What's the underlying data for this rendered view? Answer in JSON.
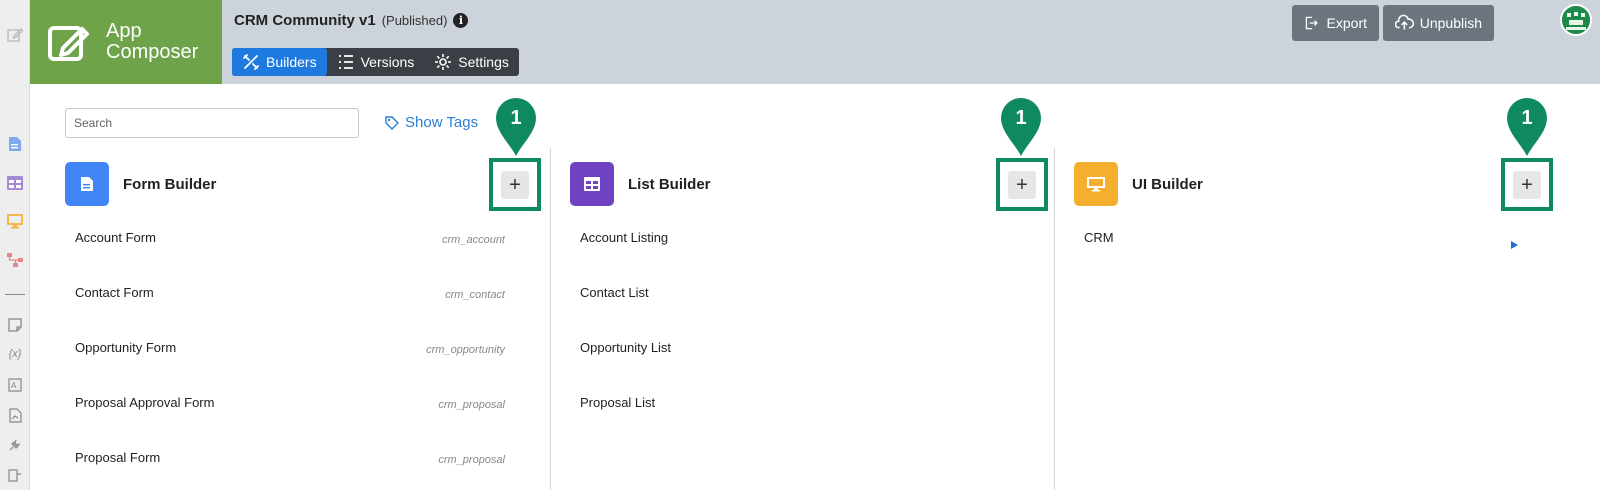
{
  "brand": {
    "line1": "App",
    "line2": "Composer"
  },
  "app": {
    "title": "CRM Community v1",
    "status": "(Published)",
    "info_icon": "i"
  },
  "tabs": [
    {
      "label": "Builders",
      "icon": "tools-icon",
      "active": true
    },
    {
      "label": "Versions",
      "icon": "list-icon",
      "active": false
    },
    {
      "label": "Settings",
      "icon": "gear-icon",
      "active": false
    }
  ],
  "header_buttons": {
    "export": "Export",
    "unpublish": "Unpublish"
  },
  "search": {
    "placeholder": "Search",
    "value": ""
  },
  "show_tags": "Show Tags",
  "badge": "1",
  "add_symbol": "+",
  "builders": {
    "form": {
      "title": "Form Builder",
      "color": "#4285f4",
      "items": [
        {
          "name": "Account Form",
          "tag": "crm_account"
        },
        {
          "name": "Contact Form",
          "tag": "crm_contact"
        },
        {
          "name": "Opportunity Form",
          "tag": "crm_opportunity"
        },
        {
          "name": "Proposal Approval Form",
          "tag": "crm_proposal"
        },
        {
          "name": "Proposal Form",
          "tag": "crm_proposal"
        }
      ]
    },
    "list": {
      "title": "List Builder",
      "color": "#6f42c1",
      "items": [
        {
          "name": "Account Listing"
        },
        {
          "name": "Contact List"
        },
        {
          "name": "Opportunity List"
        },
        {
          "name": "Proposal List"
        }
      ]
    },
    "ui": {
      "title": "UI Builder",
      "color": "#f4b02c",
      "items": [
        {
          "name": "CRM"
        }
      ]
    }
  },
  "colors": {
    "brand": "#6ea34a",
    "header": "#ccd3da",
    "accent": "#1f7ae0",
    "highlight": "#0f8a5f"
  }
}
